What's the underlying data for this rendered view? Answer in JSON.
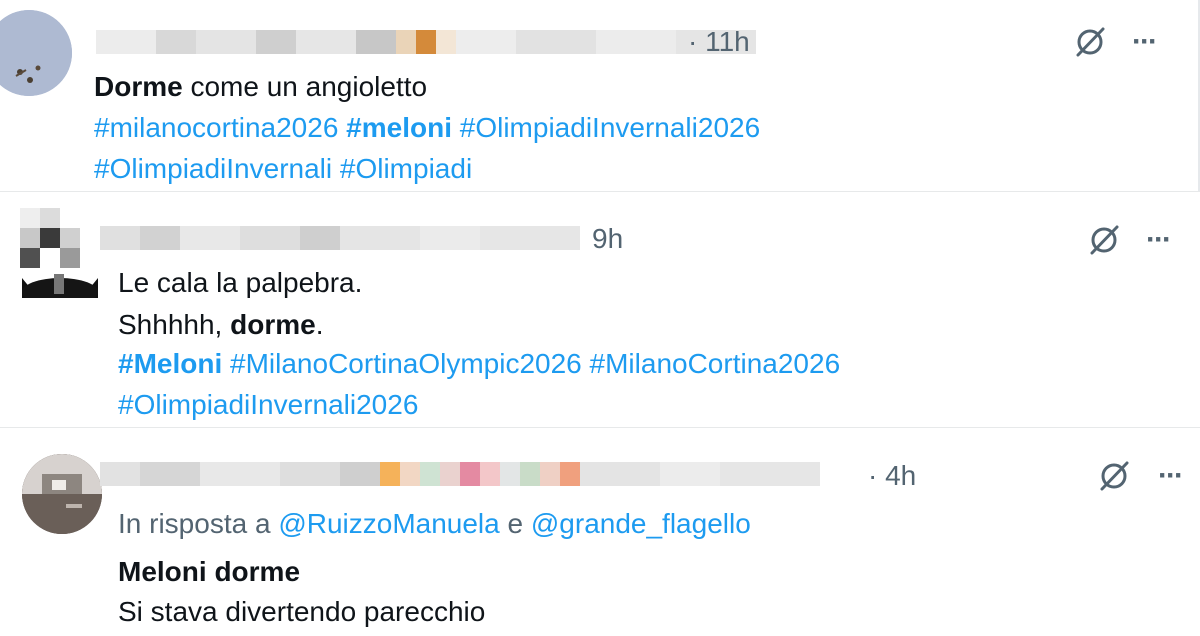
{
  "tweets": [
    {
      "time": "· 11h",
      "lines": [
        [
          {
            "t": "Dorme",
            "style": "bold"
          },
          {
            "t": " come un angioletto",
            "style": "plain"
          }
        ],
        [
          {
            "t": "#milanocortina2026",
            "style": "tag"
          },
          {
            "t": " ",
            "style": "plain"
          },
          {
            "t": "#meloni",
            "style": "tag-bold"
          },
          {
            "t": " ",
            "style": "plain"
          },
          {
            "t": "#OlimpiadiInvernali2026",
            "style": "tag"
          }
        ],
        [
          {
            "t": "#OlimpiadiInvernali",
            "style": "tag"
          },
          {
            "t": " ",
            "style": "plain"
          },
          {
            "t": "#Olimpiadi",
            "style": "tag"
          }
        ]
      ]
    },
    {
      "time": "9h",
      "lines": [
        [
          {
            "t": "Le cala la palpebra.",
            "style": "plain"
          }
        ],
        [
          {
            "t": "Shhhhh, ",
            "style": "plain"
          },
          {
            "t": "dorme",
            "style": "bold"
          },
          {
            "t": ".",
            "style": "plain"
          }
        ],
        [
          {
            "t": "#Meloni",
            "style": "tag-bold"
          },
          {
            "t": " ",
            "style": "plain"
          },
          {
            "t": "#MilanoCortinaOlympic2026",
            "style": "tag"
          },
          {
            "t": " ",
            "style": "plain"
          },
          {
            "t": "#MilanoCortina2026",
            "style": "tag"
          }
        ],
        [
          {
            "t": "#OlimpiadiInvernali2026",
            "style": "tag"
          }
        ]
      ]
    },
    {
      "time": "· 4h",
      "lines": [
        [
          {
            "t": "In risposta a ",
            "style": "muted"
          },
          {
            "t": "@RuizzoManuela",
            "style": "tag"
          },
          {
            "t": " e ",
            "style": "muted"
          },
          {
            "t": "@grande_flagello",
            "style": "tag"
          }
        ],
        [
          {
            "t": "Meloni dorme",
            "style": "bold"
          }
        ],
        [
          {
            "t": "Si stava divertendo parecchio",
            "style": "plain"
          }
        ]
      ]
    }
  ],
  "icons": {
    "grok": "grok-slash-icon",
    "more": "more-dots-icon",
    "more_label": "···"
  },
  "colors": {
    "hashtag": "#1d9bf0",
    "secondary": "#536471",
    "text": "#0f1419"
  }
}
